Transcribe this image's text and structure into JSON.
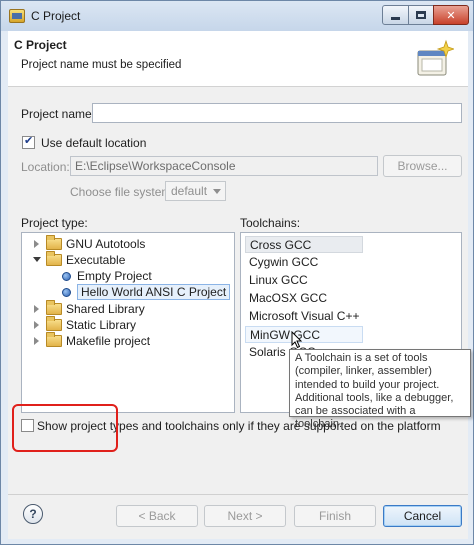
{
  "window": {
    "title": "C Project"
  },
  "banner": {
    "title": "C Project",
    "message": "Project name must be specified"
  },
  "form": {
    "project_name_label": "Project name:",
    "project_name_value": "",
    "use_default_location_label": "Use default location",
    "use_default_location_checked": true,
    "location_label": "Location:",
    "location_value": "E:\\Eclipse\\WorkspaceConsole",
    "browse_label": "Browse...",
    "choose_fs_label": "Choose file system:",
    "choose_fs_value": "default"
  },
  "project_type": {
    "label": "Project type:",
    "items": [
      {
        "label": "GNU Autotools",
        "expanded": false
      },
      {
        "label": "Executable",
        "expanded": true
      },
      {
        "label": "Empty Project"
      },
      {
        "label": "Hello World ANSI C Project",
        "selected": true
      },
      {
        "label": "Shared Library",
        "expanded": false
      },
      {
        "label": "Static Library",
        "expanded": false
      },
      {
        "label": "Makefile project",
        "expanded": false
      }
    ]
  },
  "toolchains": {
    "label": "Toolchains:",
    "items": [
      {
        "label": "Cross GCC",
        "selected": true
      },
      {
        "label": "Cygwin GCC"
      },
      {
        "label": "Linux GCC"
      },
      {
        "label": "MacOSX GCC"
      },
      {
        "label": "Microsoft Visual C++"
      },
      {
        "label": "MinGW GCC",
        "hovered": true
      },
      {
        "label": "Solaris GCC"
      }
    ]
  },
  "tooltip": {
    "lines": [
      "A Toolchain is a set of tools",
      "(compiler, linker, assembler)",
      "intended to build your project.",
      "Additional tools, like a debugger,",
      "can be associated with a toolchain."
    ]
  },
  "filter": {
    "label": "Show project types and toolchains only if they are supported on the platform",
    "checked": false
  },
  "footer": {
    "help": "?",
    "back": "< Back",
    "next": "Next >",
    "finish": "Finish",
    "cancel": "Cancel"
  },
  "colors": {
    "highlight_outline": "#e0201b",
    "title_bar": "#c6d6ea",
    "close_button": "#c8412b"
  }
}
